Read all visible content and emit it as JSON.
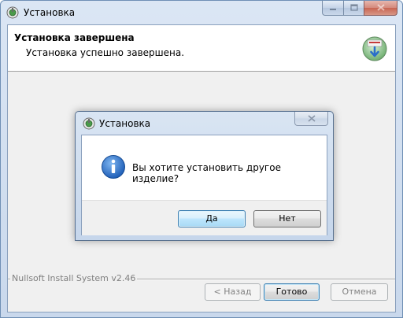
{
  "main_window": {
    "title": "Установка",
    "header": {
      "title": "Установка завершена",
      "subtitle": "Установка успешно завершена."
    },
    "branding": "Nullsoft Install System v2.46",
    "buttons": {
      "back": "< Назад",
      "done": "Готово",
      "cancel": "Отмена"
    }
  },
  "dialog": {
    "title": "Установка",
    "message": "Вы хотите установить другое изделие?",
    "buttons": {
      "yes": "Да",
      "no": "Нет"
    },
    "icon": "info-icon"
  },
  "colors": {
    "titlebar": "#c9d8ec",
    "window_face": "#f0f0f0",
    "default_button_border": "#3c7fb1",
    "info_icon": "#2a6ec9"
  }
}
